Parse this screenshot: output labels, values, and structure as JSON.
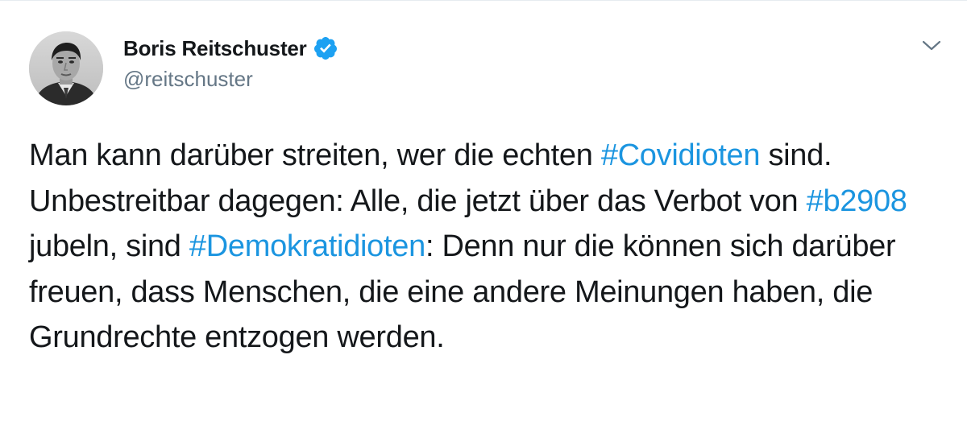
{
  "user": {
    "display_name": "Boris Reitschuster",
    "handle": "@reitschuster",
    "verified_icon": "verified-badge-icon",
    "avatar": "profile-photo-grayscale"
  },
  "tweet": {
    "text_segments": [
      "Man kann darüber streiten, wer die echten ",
      "#Covidioten",
      " sind. Unbestreitbar dagegen: Alle, die jetzt über das Verbot von ",
      "#b2908",
      " jubeln, sind ",
      "#Demokratidioten",
      ": Denn nur die können sich darüber freuen, dass Menschen, die eine andere Meinungen haben, die Grundrechte entzogen werden."
    ]
  },
  "menu": {
    "icon": "chevron-down-icon"
  },
  "colors": {
    "text": "#14171a",
    "secondary": "#657786",
    "link": "#1b95e0",
    "verified": "#1da1f2",
    "divider": "#e6ecf0"
  }
}
